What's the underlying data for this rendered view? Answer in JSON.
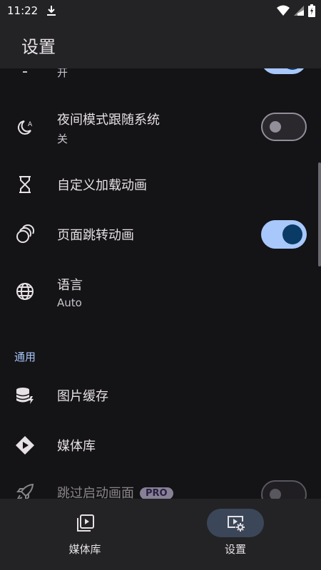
{
  "status_bar": {
    "time": "11:22"
  },
  "app_bar": {
    "title": "设置"
  },
  "settings": {
    "partial_row": {
      "subtitle": "开",
      "toggle_on": true
    },
    "night_mode": {
      "title": "夜间模式跟随系统",
      "subtitle": "关",
      "toggle_on": false,
      "icon": "night-mode-auto-icon"
    },
    "custom_loading": {
      "title": "自定义加载动画",
      "icon": "hourglass-icon"
    },
    "page_transition": {
      "title": "页面跳转动画",
      "toggle_on": true,
      "icon": "animation-icon"
    },
    "language": {
      "title": "语言",
      "subtitle": "Auto",
      "icon": "globe-icon"
    },
    "section_general": {
      "label": "通用"
    },
    "image_cache": {
      "title": "图片缓存",
      "icon": "storage-icon"
    },
    "media_library": {
      "title": "媒体库",
      "icon": "media-library-icon"
    },
    "skip_splash": {
      "title": "跳过启动画面",
      "badge": "PRO",
      "toggle_on": false,
      "icon": "rocket-icon"
    }
  },
  "bottom_nav": {
    "items": [
      {
        "label": "媒体库",
        "icon": "video-library-icon",
        "active": false
      },
      {
        "label": "设置",
        "icon": "video-settings-icon",
        "active": true
      }
    ]
  },
  "colors": {
    "background": "#141316",
    "surface": "#232326",
    "accent": "#a8c7fa",
    "toggle_knob_on": "#0a3a66",
    "pro_badge": "#e7dcff"
  }
}
